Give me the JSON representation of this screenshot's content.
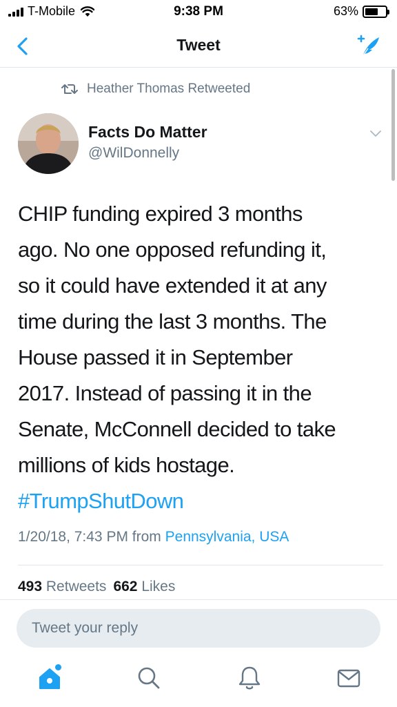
{
  "status_bar": {
    "carrier": "T-Mobile",
    "time": "9:38 PM",
    "battery": "63%",
    "battery_level": 0.63
  },
  "nav": {
    "title": "Tweet",
    "back_icon": "chevron-left-icon",
    "compose_icon": "compose-tweet-icon"
  },
  "retweet_context": {
    "text": "Heather Thomas Retweeted",
    "icon": "retweet-icon"
  },
  "author": {
    "name": "Facts Do Matter",
    "handle": "@WilDonnelly"
  },
  "tweet": {
    "lines": [
      "CHIP funding expired 3 months",
      "ago. No one opposed refunding it,",
      "so it could have extended it at any",
      "time during the last 3 months. The",
      "House passed it in September",
      "2017. Instead of passing it in the",
      "Senate, McConnell decided to take",
      "millions of kids hostage."
    ],
    "hashtag": "#TrumpShutDown",
    "timestamp": "1/20/18, 7:43 PM",
    "from_label": "from",
    "location": "Pennsylvania, USA"
  },
  "stats": {
    "retweets_count": "493",
    "retweets_label": "Retweets",
    "likes_count": "662",
    "likes_label": "Likes"
  },
  "reply": {
    "placeholder": "Tweet your reply"
  },
  "tabbar": {
    "items": [
      "home-icon",
      "search-icon",
      "notifications-icon",
      "messages-icon"
    ]
  },
  "colors": {
    "accent": "#1da1f2",
    "secondary_text": "#657786",
    "primary_text": "#14171a",
    "divider": "#e1e8ed",
    "reply_bg": "#e6ecf0"
  }
}
